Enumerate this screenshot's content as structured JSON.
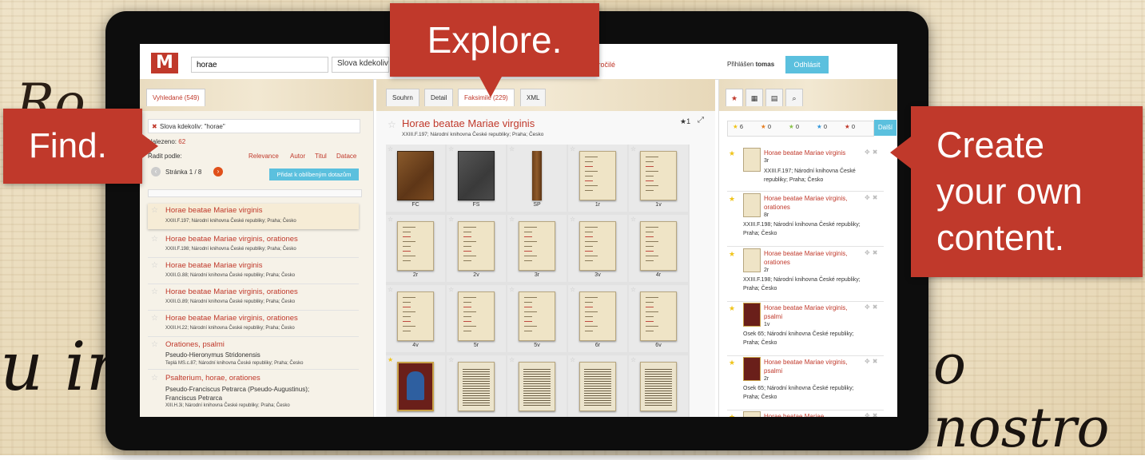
{
  "colors": {
    "accent": "#c0392b",
    "button": "#5bc0de",
    "star": "#f0c419"
  },
  "header": {
    "logo": "M",
    "search_value": "horae",
    "search_mode": "Slova kdekoliv",
    "advanced_link": "Pokročilé",
    "logged_in_label": "Přihlášen",
    "logged_in_user": "tomas",
    "logout_button": "Odhlásit"
  },
  "left": {
    "tab": "Vyhledané (549)",
    "filter": "Slova kdekoliv: \"horae\"",
    "found_label": "Nalezeno:",
    "found_count": "62",
    "sort_label": "Řadit podle:",
    "sort_options": [
      "Relevance",
      "Autor",
      "Titul",
      "Datace"
    ],
    "pager_label": "Stránka 1 / 8",
    "add_saved_button": "Přidat k oblíbeným dotazům",
    "results": [
      {
        "title": "Horae beatae Mariae virginis",
        "author": "",
        "meta": "XXIII.F.197; Národní knihovna České republiky; Praha; Česko"
      },
      {
        "title": "Horae beatae Mariae virginis, orationes",
        "author": "",
        "meta": "XXIII.F.198; Národní knihovna České republiky; Praha; Česko"
      },
      {
        "title": "Horae beatae Mariae virginis",
        "author": "",
        "meta": "XXIII.G.88; Národní knihovna České republiky; Praha; Česko"
      },
      {
        "title": "Horae beatae Mariae virginis, orationes",
        "author": "",
        "meta": "XXIII.G.89; Národní knihovna České republiky; Praha; Česko"
      },
      {
        "title": "Horae beatae Mariae virginis, orationes",
        "author": "",
        "meta": "XXIII.H.22; Národní knihovna České republiky; Praha; Česko"
      },
      {
        "title": "Orationes, psalmi",
        "author": "Pseudo-Hieronymus Stridonensis",
        "meta": "Teplá MS.c.87; Národní knihovna České republiky; Praha; Česko"
      },
      {
        "title": "Psalterium, horae, orationes",
        "author": "Pseudo-Franciscus Petrarca (Pseudo-Augustinus); Franciscus Petrarca",
        "meta": "XIII.H.3i; Národní knihovna České republiky; Praha; Česko"
      }
    ]
  },
  "middle": {
    "tabs": [
      "Souhrn",
      "Detail",
      "Faksimile (229)",
      "XML"
    ],
    "title": "Horae beatae Mariae virginis",
    "meta": "XXIII.F.197; Národní knihovna České republiky; Praha; Česko",
    "fav_count": "★1",
    "expand_icon": "expand-icon",
    "thumbnails": [
      {
        "label": "FC",
        "kind": "cover1"
      },
      {
        "label": "FS",
        "kind": "cover2"
      },
      {
        "label": "SP",
        "kind": "spine"
      },
      {
        "label": "1r",
        "kind": "parch"
      },
      {
        "label": "1v",
        "kind": "parch"
      },
      {
        "label": "2r",
        "kind": "parch"
      },
      {
        "label": "2v",
        "kind": "parch"
      },
      {
        "label": "3r",
        "kind": "parch"
      },
      {
        "label": "3v",
        "kind": "parch"
      },
      {
        "label": "4r",
        "kind": "parch"
      },
      {
        "label": "4v",
        "kind": "parch"
      },
      {
        "label": "5r",
        "kind": "parch"
      },
      {
        "label": "5v",
        "kind": "parch"
      },
      {
        "label": "6r",
        "kind": "parch"
      },
      {
        "label": "6v",
        "kind": "parch"
      },
      {
        "label": "",
        "kind": "illum",
        "fav": true
      },
      {
        "label": "",
        "kind": "text"
      },
      {
        "label": "",
        "kind": "text"
      },
      {
        "label": "",
        "kind": "text"
      },
      {
        "label": "",
        "kind": "text"
      }
    ]
  },
  "right": {
    "tabs": [
      "★",
      "▦",
      "▤",
      "⌕"
    ],
    "filters": [
      "6",
      "0",
      "0",
      "0",
      "0"
    ],
    "filter_colors": [
      "#f0c419",
      "#e67e22",
      "#8bc34a",
      "#3498db",
      "#c0392b"
    ],
    "next_button": "Další",
    "favorites": [
      {
        "title": "Horae beatae Mariae virginis",
        "page": "3r",
        "meta": "XXIII.F.197; Národní knihovna České republiky; Praha; Česko",
        "illum": false
      },
      {
        "title": "Horae beatae Mariae virginis, orationes",
        "page": "8r",
        "meta": "XXIII.F.198; Národní knihovna České republiky; Praha; Česko",
        "illum": false
      },
      {
        "title": "Horae beatae Mariae virginis, orationes",
        "page": "2r",
        "meta": "XXIII.F.198; Národní knihovna České republiky; Praha; Česko",
        "illum": false
      },
      {
        "title": "Horae beatae Mariae virginis, psalmi",
        "page": "1v",
        "meta": "Osek 65; Národní knihovna České republiky; Praha; Česko",
        "illum": true
      },
      {
        "title": "Horae beatae Mariae virginis, psalmi",
        "page": "2r",
        "meta": "Osek 65; Národní knihovna České republiky; Praha; Česko",
        "illum": true
      },
      {
        "title": "Horae beatae Mariae",
        "page": "",
        "meta": "",
        "illum": false
      }
    ]
  },
  "callouts": {
    "explore": "Explore.",
    "find": "Find.",
    "create_lines": [
      "Create",
      "your own",
      "content."
    ]
  },
  "background_text": {
    "left": "u in",
    "right": "o nostro",
    "top_left": "Ro"
  }
}
